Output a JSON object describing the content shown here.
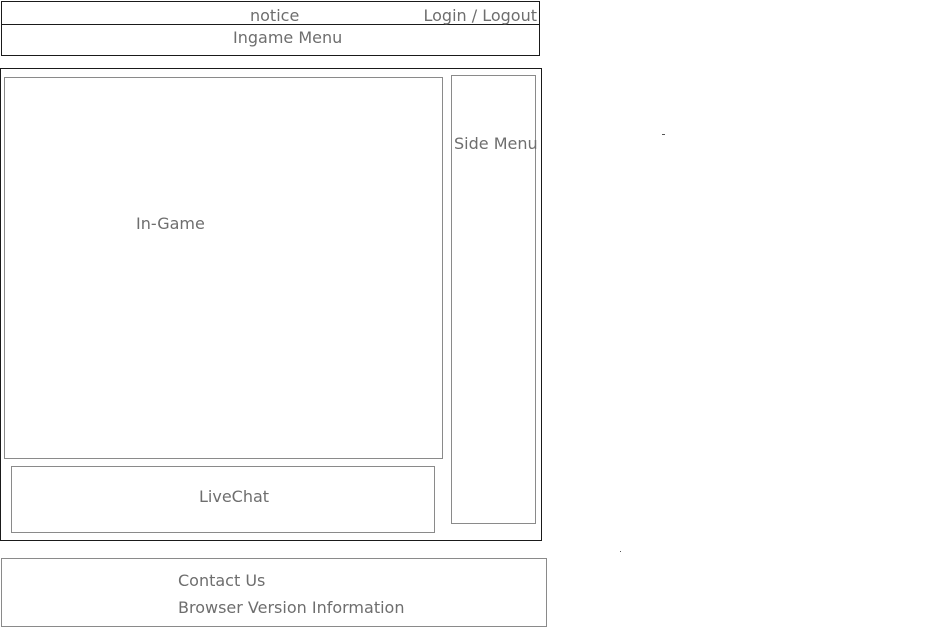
{
  "header": {
    "notice": "notice",
    "auth": "Login / Logout",
    "menu": "Ingame Menu"
  },
  "main": {
    "ingame": "In-Game",
    "livechat": "LiveChat",
    "side_menu": "Side Menu"
  },
  "footer": {
    "contact": "Contact Us",
    "browser_info": "Browser Version Information"
  }
}
